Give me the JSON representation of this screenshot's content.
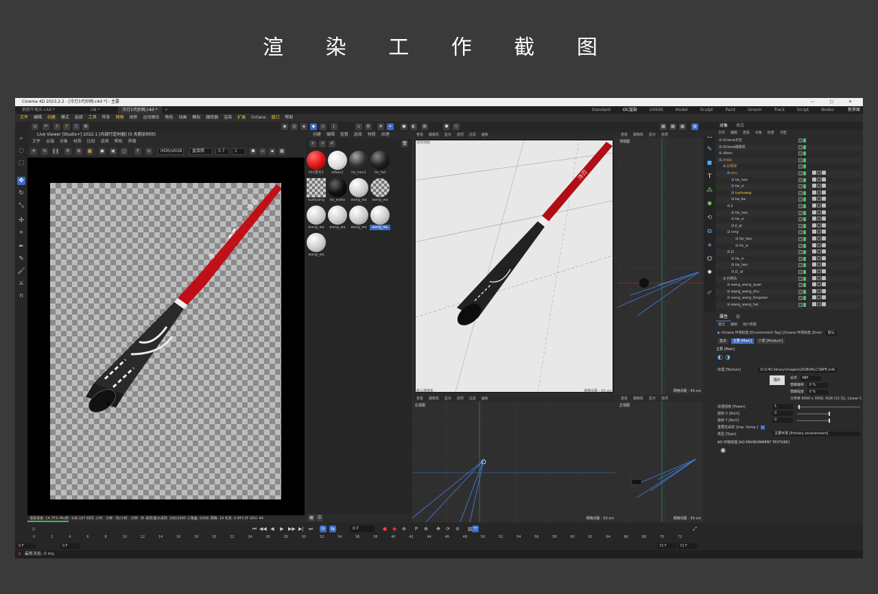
{
  "page_heading": "渲 染 工 作 截 图",
  "window": {
    "title": "Cinema 4D 2023.2.2 - [冷刃1代抄网.c4d *] - 主要",
    "doc_tabs": [
      "钢炼牛角头.c4d *",
      "UB *",
      "冷刃1代抄网.c4d *"
    ],
    "add_tab": "+",
    "layouts": [
      "Standard",
      "OC渲染",
      "UVEdit",
      "Model",
      "Sculpt",
      "Paint",
      "Groom",
      "Track",
      "Script",
      "Nodes"
    ],
    "active_layout": "OC渲染",
    "new_version": "新界面"
  },
  "menubar": [
    "文件",
    "编辑",
    "创建",
    "模式",
    "选择",
    "工具",
    "样条",
    "网格",
    "体积",
    "运动图形",
    "角色",
    "动画",
    "模拟",
    "跟踪器",
    "渲染",
    "扩展",
    "Octane",
    "窗口",
    "帮助"
  ],
  "toolbar": {
    "axis_x": "X",
    "axis_y": "Y",
    "axis_z": "Z"
  },
  "live_viewer": {
    "title": "Live Viewer [Studio+] 2022.1 [内部行定时器] (0 天剩余时间)",
    "menu": [
      "文件",
      "云端",
      "对象",
      "材质",
      "比较",
      "选项",
      "帮助",
      "界面"
    ],
    "mode_select": "HDR/sRGB",
    "channel_select": "直接照",
    "value_a": "0.7",
    "value_b": "1",
    "status": "渲染进度: 14.75%  Ms/秒: 106.167  时间: 小时 : 分钟 : 秒/小时 : 分钟 : 秒  采样/最大采样: 295/2000  三角面: 0/93k  网格: 19  毛发: 0  RTX:开  GPU: 44"
  },
  "material_manager": {
    "menu": [
      "创建",
      "编辑",
      "查看",
      "选择",
      "材质",
      "纹理"
    ],
    "materials": [
      {
        "name": "Oct发光1"
      },
      {
        "name": "diban1"
      },
      {
        "name": "tie_hen1"
      },
      {
        "name": "tie_hei"
      },
      {
        "name": "tuzhuang"
      },
      {
        "name": "ba_woba"
      },
      {
        "name": "wang_wa"
      },
      {
        "name": "wang_wa"
      },
      {
        "name": "wang_wa"
      },
      {
        "name": "wang_wa"
      },
      {
        "name": "wang_wa"
      },
      {
        "name": "wang_wa"
      },
      {
        "name": "wang_wa"
      }
    ]
  },
  "viewports": {
    "menu": [
      "查看",
      "摄像机",
      "显示",
      "选项",
      "过滤",
      "面板"
    ],
    "persp": {
      "label": "透视视图",
      "grid": "网格间距 : 50 cm",
      "corner_a": "默认摄像机 ·",
      "corner_b": "网格间距 : 50 cm"
    },
    "top": {
      "label": "顶视图",
      "grid": "网格间距 : 50 cm"
    },
    "right": {
      "label": "右视图",
      "grid": "网格间距 : 50 cm"
    },
    "front": {
      "label": "正视图",
      "grid": "网格间距 : 50 cm"
    }
  },
  "object_manager": {
    "tabs": [
      "对象",
      "场次"
    ],
    "menu": [
      "文件",
      "编辑",
      "查看",
      "对象",
      "标签",
      "书签"
    ],
    "rows": [
      {
        "name": "Octane天空",
        "indent": 0
      },
      {
        "name": "Octane摄像机",
        "indent": 0
      },
      {
        "name": "diban",
        "indent": 0
      },
      {
        "name": "zhijia",
        "indent": 0,
        "color": "orange"
      },
      {
        "name": "抄网手",
        "indent": 1,
        "color": "orange"
      },
      {
        "name": "zhu",
        "indent": 2,
        "color": "orange"
      },
      {
        "name": "tie_hen",
        "indent": 3
      },
      {
        "name": "tie_si",
        "indent": 3
      },
      {
        "name": "tuzhuang",
        "indent": 3,
        "color": "yellow"
      },
      {
        "name": "ba_ba",
        "indent": 3
      },
      {
        "name": "ji",
        "indent": 2
      },
      {
        "name": "tie_hen",
        "indent": 3
      },
      {
        "name": "tie_si",
        "indent": 3
      },
      {
        "name": "ji_qi",
        "indent": 3
      },
      {
        "name": "ning",
        "indent": 2
      },
      {
        "name": "tie_hen",
        "indent": 4
      },
      {
        "name": "tie_si",
        "indent": 4
      },
      {
        "name": "j1",
        "indent": 2
      },
      {
        "name": "tie_si",
        "indent": 3
      },
      {
        "name": "tie_hen",
        "indent": 3
      },
      {
        "name": "j1_qi",
        "indent": 3
      },
      {
        "name": "抄网头",
        "indent": 1
      },
      {
        "name": "wang_wang_quan",
        "indent": 2
      },
      {
        "name": "wang_wang_zhu",
        "indent": 2
      },
      {
        "name": "wang_wang_fengxian",
        "indent": 2
      },
      {
        "name": "wang_wang_hei",
        "indent": 2
      }
    ]
  },
  "attributes": {
    "tabs": [
      "属性",
      "层"
    ],
    "menu": [
      "模式",
      "编辑",
      "用户数据"
    ],
    "header": "Octane 环境标签 [Environment Tag] [Octane 环境标签 [Envir",
    "header_mode": "默认",
    "subtabs": [
      "基本",
      "主要 [Main]",
      "介质 [Medium]"
    ],
    "active_subtab": "主要 [Main]",
    "section": "主要 [Main]",
    "texture_label": "纹理 [Texture]",
    "texture_path": "D:\\C4D.library\\images\\LRO8URLC7JAFE.info",
    "image_label": "图片",
    "sampling_label": "采样",
    "sampling_value": "MIP",
    "blur_offset_label": "模糊偏移",
    "blur_offset_value": "0 %",
    "blur_degree_label": "模糊程度",
    "blur_degree_value": "0 %",
    "resolution": "分辨率 6000 x 3000, RGB (32 位), Linear Color Space",
    "power_label": "纹理强度 [Power]",
    "power_value": "1.",
    "rotx_label": "旋转 X [RotX]",
    "rotx_value": "0",
    "roty_label": "旋转 Y [RotY]",
    "roty_value": "0",
    "imp_label": "重要性采样 [Imp. Samp.]",
    "type_label": "类型 [Type]",
    "type_value": "主要环境 [Primary environment]",
    "ao_section": "AO 环境纹理 [AO ENVIRONMENT TEXTURE]"
  },
  "timeline": {
    "current_frame": "0 F",
    "start_field": "0 F",
    "start_field2": "0 F",
    "end_field": "72 F",
    "end_field2": "72 F",
    "ticks": [
      "0",
      "2",
      "4",
      "6",
      "8",
      "10",
      "12",
      "14",
      "16",
      "18",
      "20",
      "22",
      "24",
      "26",
      "28",
      "30",
      "32",
      "34",
      "36",
      "38",
      "40",
      "42",
      "44",
      "46",
      "48",
      "50",
      "52",
      "54",
      "56",
      "58",
      "60",
      "62",
      "64",
      "66",
      "68",
      "70",
      "72"
    ]
  },
  "statusbar": {
    "text": "最新消息: 0 ms."
  },
  "colors": {
    "accent": "#3d6ac6",
    "rod_red": "#c8101a",
    "bg": "#3a3a3a"
  }
}
